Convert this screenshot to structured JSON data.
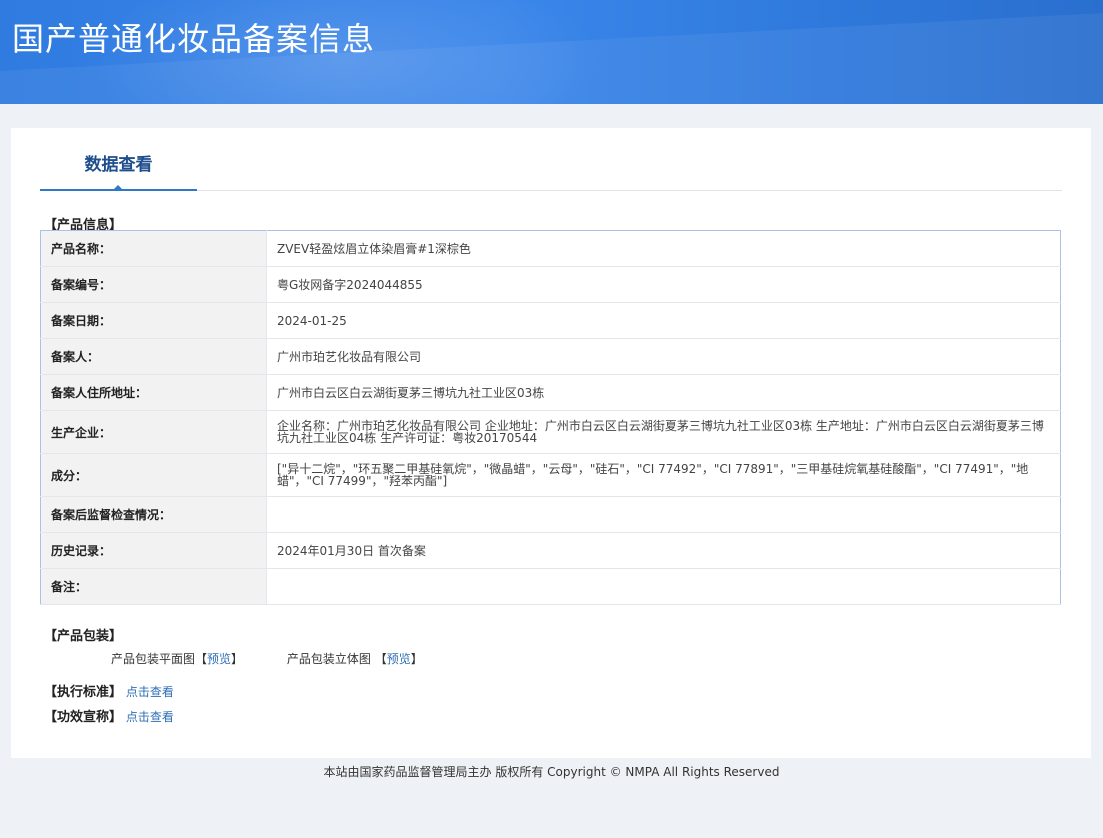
{
  "header": {
    "title": "国产普通化妆品备案信息"
  },
  "tabs": [
    {
      "label": "数据查看"
    }
  ],
  "product_info": {
    "section_label": "【产品信息】",
    "rows": [
      {
        "label": "产品名称：",
        "value": "ZVEV轻盈炫眉立体染眉膏#1深棕色"
      },
      {
        "label": "备案编号：",
        "value": "粤G妆网备字2024044855"
      },
      {
        "label": "备案日期：",
        "value": "2024-01-25"
      },
      {
        "label": "备案人：",
        "value": "广州市珀艺化妆品有限公司"
      },
      {
        "label": "备案人住所地址：",
        "value": "广州市白云区白云湖街夏茅三博坑九社工业区03栋"
      },
      {
        "label": "生产企业：",
        "value": "企业名称：广州市珀艺化妆品有限公司 企业地址：广州市白云区白云湖街夏茅三博坑九社工业区03栋 生产地址：广州市白云区白云湖街夏茅三博坑九社工业区04栋 生产许可证：粤妆20170544"
      },
      {
        "label": "成分：",
        "value": "[\"异十二烷\"，\"环五聚二甲基硅氧烷\"，\"微晶蜡\"，\"云母\"，\"硅石\"，\"CI 77492\"，\"CI 77891\"，\"三甲基硅烷氧基硅酸酯\"，\"CI 77491\"，\"地蜡\"，\"CI 77499\"，\"羟苯丙酯\"]"
      },
      {
        "label": "备案后监督检查情况：",
        "value": ""
      },
      {
        "label": "历史记录：",
        "value": "2024年01月30日 首次备案"
      },
      {
        "label": "备注：",
        "value": ""
      }
    ]
  },
  "packaging": {
    "section_label": "【产品包装】",
    "flat_label": "产品包装平面图",
    "stereo_label": "产品包装立体图",
    "bracket_open": "【",
    "bracket_close": "】",
    "preview_link": "预览"
  },
  "standard": {
    "label": "【执行标准】",
    "link": "点击查看"
  },
  "efficacy": {
    "label": "【功效宣称】",
    "link": "点击查看"
  },
  "footer": {
    "text": "本站由国家药品监督管理局主办 版权所有 Copyright © NMPA All Rights Reserved"
  },
  "colors": {
    "header_blue": "#3182e4",
    "tab_accent": "#2f78c4",
    "link": "#2f6fb4",
    "table_border": "#a9c3e6"
  }
}
